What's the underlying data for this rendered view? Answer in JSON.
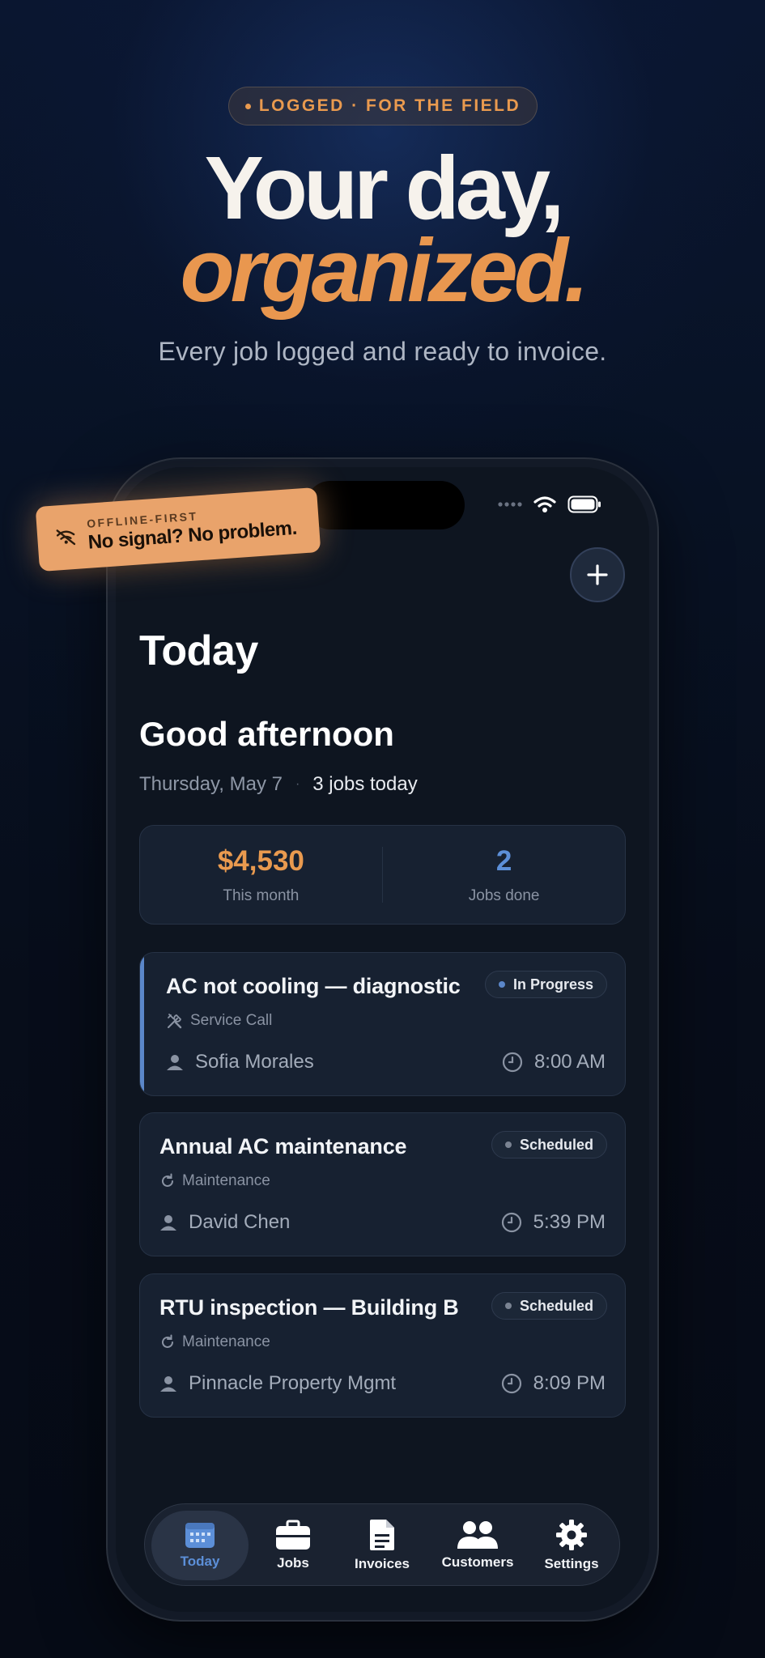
{
  "hero": {
    "tag": "LOGGED · FOR THE FIELD",
    "title_line1": "Your day,",
    "title_line2": "organized.",
    "subtitle": "Every job logged and ready to invoice."
  },
  "sticker": {
    "eyebrow": "OFFLINE-FIRST",
    "text": "No signal? No problem.",
    "icon": "wifi-off-icon"
  },
  "screen": {
    "page_title": "Today",
    "greeting": "Good afternoon",
    "date": "Thursday, May 7",
    "jobs_today": "3 jobs today"
  },
  "stats": [
    {
      "value": "$4,530",
      "label": "This month",
      "color": "#e99a4f"
    },
    {
      "value": "2",
      "label": "Jobs done",
      "color": "#5c8fd8"
    }
  ],
  "jobs": [
    {
      "title": "AC not cooling — diagnostic",
      "type": "Service Call",
      "type_icon": "tools-icon",
      "customer": "Sofia Morales",
      "time": "8:00 AM",
      "status": "In Progress",
      "status_color": "#5b87c9"
    },
    {
      "title": "Annual AC maintenance",
      "type": "Maintenance",
      "type_icon": "refresh-icon",
      "customer": "David Chen",
      "time": "5:39 PM",
      "status": "Scheduled",
      "status_color": "#7a8392"
    },
    {
      "title": "RTU inspection — Building B",
      "type": "Maintenance",
      "type_icon": "refresh-icon",
      "customer": "Pinnacle Property Mgmt",
      "time": "8:09 PM",
      "status": "Scheduled",
      "status_color": "#7a8392"
    }
  ],
  "tabs": [
    {
      "label": "Today",
      "icon": "calendar-icon",
      "active": true
    },
    {
      "label": "Jobs",
      "icon": "briefcase-icon",
      "active": false
    },
    {
      "label": "Invoices",
      "icon": "document-icon",
      "active": false
    },
    {
      "label": "Customers",
      "icon": "people-icon",
      "active": false
    },
    {
      "label": "Settings",
      "icon": "gear-icon",
      "active": false
    }
  ],
  "colors": {
    "accent_orange": "#e99a4f",
    "accent_blue": "#5c8fd8",
    "background": "#070e1b"
  }
}
